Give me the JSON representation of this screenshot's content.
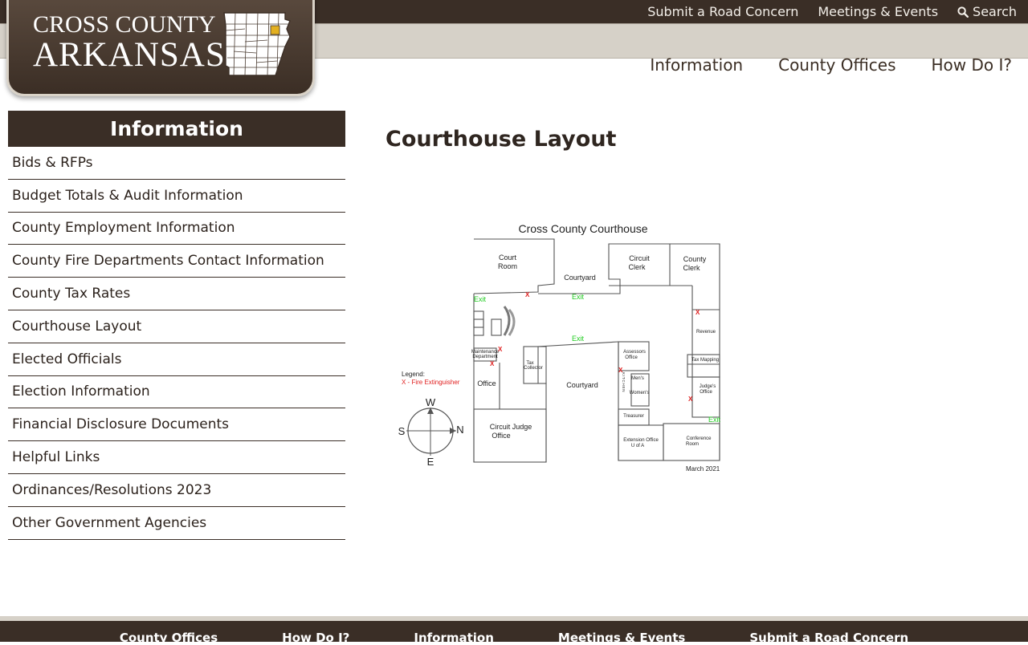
{
  "logo": {
    "line1": "CROSS COUNTY",
    "line2": "ARKANSAS"
  },
  "utility_nav": {
    "road_concern": "Submit a Road Concern",
    "meetings": "Meetings & Events",
    "search": "Search"
  },
  "main_nav": [
    "Information",
    "County Offices",
    "How Do I?"
  ],
  "sidebar": {
    "heading": "Information",
    "items": [
      "Bids & RFPs",
      "Budget Totals & Audit Information",
      "County Employment Information",
      "County Fire Departments Contact Information",
      "County Tax Rates",
      "Courthouse Layout",
      "Elected Officials",
      "Election Information",
      "Financial Disclosure Documents",
      "Helpful Links",
      "Ordinances/Resolutions 2023",
      "Other Government Agencies"
    ]
  },
  "main": {
    "title": "Courthouse Layout"
  },
  "floorplan": {
    "title": "Cross County Courthouse",
    "rooms": {
      "court_room_1": "Court",
      "court_room_2": "Room",
      "courtyard_top": "Courtyard",
      "circuit_clerk_1": "Circuit",
      "circuit_clerk_2": "Clerk",
      "county_clerk_1": "County",
      "county_clerk_2": "Clerk",
      "revenue": "Revenue",
      "maintenance_1": "Maintenance",
      "maintenance_2": "Department",
      "tax_collector_1": "Tax",
      "tax_collector_2": "Collector",
      "office": "Office",
      "courtyard_main": "Courtyard",
      "assessors_1": "Assessors",
      "assessors_2": "Office",
      "mens": "Men's",
      "womens": "Women's",
      "treasurer": "Treasurer",
      "judges_1": "Judge's",
      "judges_2": "Office",
      "circuit_judge_1": "Circuit Judge",
      "circuit_judge_2": "Office",
      "extension_1": "Extension Office",
      "extension_2": "U of A",
      "conference_1": "Conference",
      "conference_2": "Room",
      "mapping": "Tax Mapping",
      "kitchen": "KITCHEN"
    },
    "exits": [
      "Exit",
      "Exit",
      "Exit",
      "Exit"
    ],
    "legend_title": "Legend:",
    "legend_item": "X - Fire Extinguisher",
    "extinguisher_mark": "X",
    "compass": {
      "w": "W",
      "s": "S",
      "n": "N",
      "e": "E"
    },
    "date": "March 2021"
  },
  "footer_nav": [
    "County Offices",
    "How Do I?",
    "Information",
    "Meetings & Events",
    "Submit a Road Concern"
  ],
  "colors": {
    "brand_dark": "#3a2e26",
    "nav_light": "#d6d1c8",
    "exit_green": "#22cc22",
    "extinguisher_red": "#e02020"
  }
}
